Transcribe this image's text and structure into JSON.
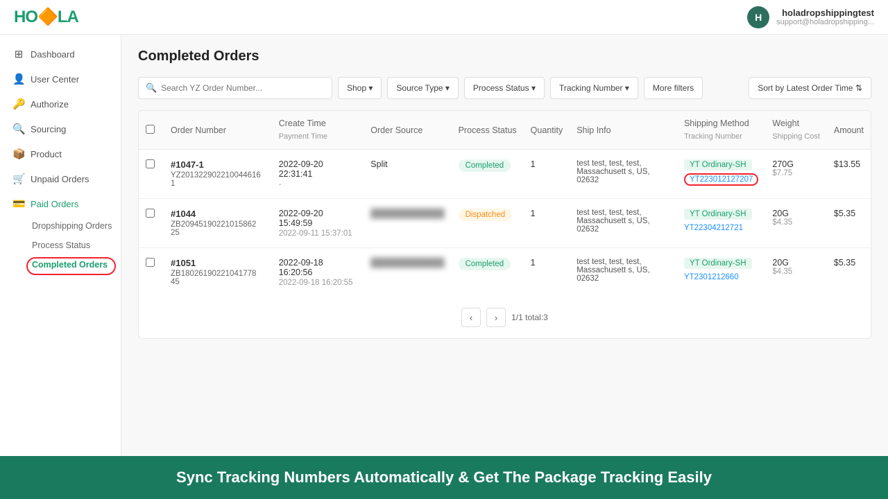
{
  "topbar": {
    "logo": "H🔶LA",
    "logo_text": "HOLA",
    "user_avatar_letter": "H",
    "user_name": "holadropshippingtest",
    "user_email": "support@holadropshipping..."
  },
  "sidebar": {
    "items": [
      {
        "id": "dashboard",
        "label": "Dashboard",
        "icon": "⊞"
      },
      {
        "id": "user-center",
        "label": "User Center",
        "icon": "👤"
      },
      {
        "id": "authorize",
        "label": "Authorize",
        "icon": "🔑"
      },
      {
        "id": "sourcing",
        "label": "Sourcing",
        "icon": "🔍"
      },
      {
        "id": "product",
        "label": "Product",
        "icon": "📦"
      },
      {
        "id": "unpaid-orders",
        "label": "Unpaid Orders",
        "icon": "🛒"
      },
      {
        "id": "paid-orders",
        "label": "Paid Orders",
        "icon": "💳"
      }
    ],
    "sub_items": [
      {
        "id": "dropshipping-orders",
        "label": "Dropshipping Orders"
      },
      {
        "id": "process-status",
        "label": "Process Status"
      },
      {
        "id": "completed-orders",
        "label": "Completed Orders",
        "active": true
      }
    ]
  },
  "page": {
    "title": "Completed Orders"
  },
  "filters": {
    "search_placeholder": "Search YZ Order Number...",
    "buttons": [
      {
        "id": "shop",
        "label": "Shop"
      },
      {
        "id": "source-type",
        "label": "Source Type"
      },
      {
        "id": "process-status",
        "label": "Process Status"
      },
      {
        "id": "tracking-number",
        "label": "Tracking Number"
      },
      {
        "id": "more-filters",
        "label": "More filters"
      }
    ],
    "sort_label": "Sort by Latest Order Time"
  },
  "table": {
    "columns": [
      {
        "id": "order-number",
        "label": "Order Number"
      },
      {
        "id": "create-time",
        "label": "Create Time",
        "sub": "Payment Time"
      },
      {
        "id": "order-source",
        "label": "Order Source"
      },
      {
        "id": "process-status",
        "label": "Process Status"
      },
      {
        "id": "quantity",
        "label": "Quantity"
      },
      {
        "id": "ship-info",
        "label": "Ship Info"
      },
      {
        "id": "shipping-method",
        "label": "Shipping Method",
        "sub": "Tracking Number"
      },
      {
        "id": "weight",
        "label": "Weight",
        "sub": "Shipping Cost"
      },
      {
        "id": "amount",
        "label": "Amount"
      }
    ],
    "rows": [
      {
        "id": "row-1",
        "order_num": "#1047-1",
        "order_id": "YZ201322902210044616​1",
        "create_time": "2022-09-20 22:31:41",
        "payment_time": "-",
        "order_source": "Split",
        "order_source_blurred": false,
        "process_status": "Completed",
        "process_status_type": "completed",
        "quantity": "1",
        "ship_info": "test test, test, test, Massachusett s, US, 02632",
        "shipping_method": "YT Ordinary-SH",
        "tracking_number": "YT223012127207",
        "tracking_circled": true,
        "weight": "270G",
        "shipping_cost": "$7.75",
        "amount": "$13.55"
      },
      {
        "id": "row-2",
        "order_num": "#1044",
        "order_id": "ZB20945190221015862​25",
        "create_time": "2022-09-20 15:49:59",
        "payment_time": "2022-09-11 15:37:01",
        "order_source": "",
        "order_source_blurred": true,
        "process_status": "Dispatched",
        "process_status_type": "dispatched",
        "quantity": "1",
        "ship_info": "test test, test, test, Massachusett s, US, 02632",
        "shipping_method": "YT Ordinary-SH",
        "tracking_number": "YT22304212721",
        "tracking_circled": false,
        "weight": "20G",
        "shipping_cost": "$4.35",
        "amount": "$5.35"
      },
      {
        "id": "row-3",
        "order_num": "#1051",
        "order_id": "ZB18026190221041778​45",
        "create_time": "2022-09-18 16:20:56",
        "payment_time": "2022-09-18 16:20:55",
        "order_source": "",
        "order_source_blurred": true,
        "process_status": "Completed",
        "process_status_type": "completed",
        "quantity": "1",
        "ship_info": "test test, test, test, Massachusett s, US, 02632",
        "shipping_method": "YT Ordinary-SH",
        "tracking_number": "YT2301212660",
        "tracking_circled": false,
        "weight": "20G",
        "shipping_cost": "$4.35",
        "amount": "$5.35"
      }
    ]
  },
  "pagination": {
    "prev_label": "‹",
    "next_label": "›",
    "page_info": "1/1 total:3"
  },
  "banner": {
    "text": "Sync Tracking Numbers Automatically & Get The Package Tracking Easily"
  }
}
